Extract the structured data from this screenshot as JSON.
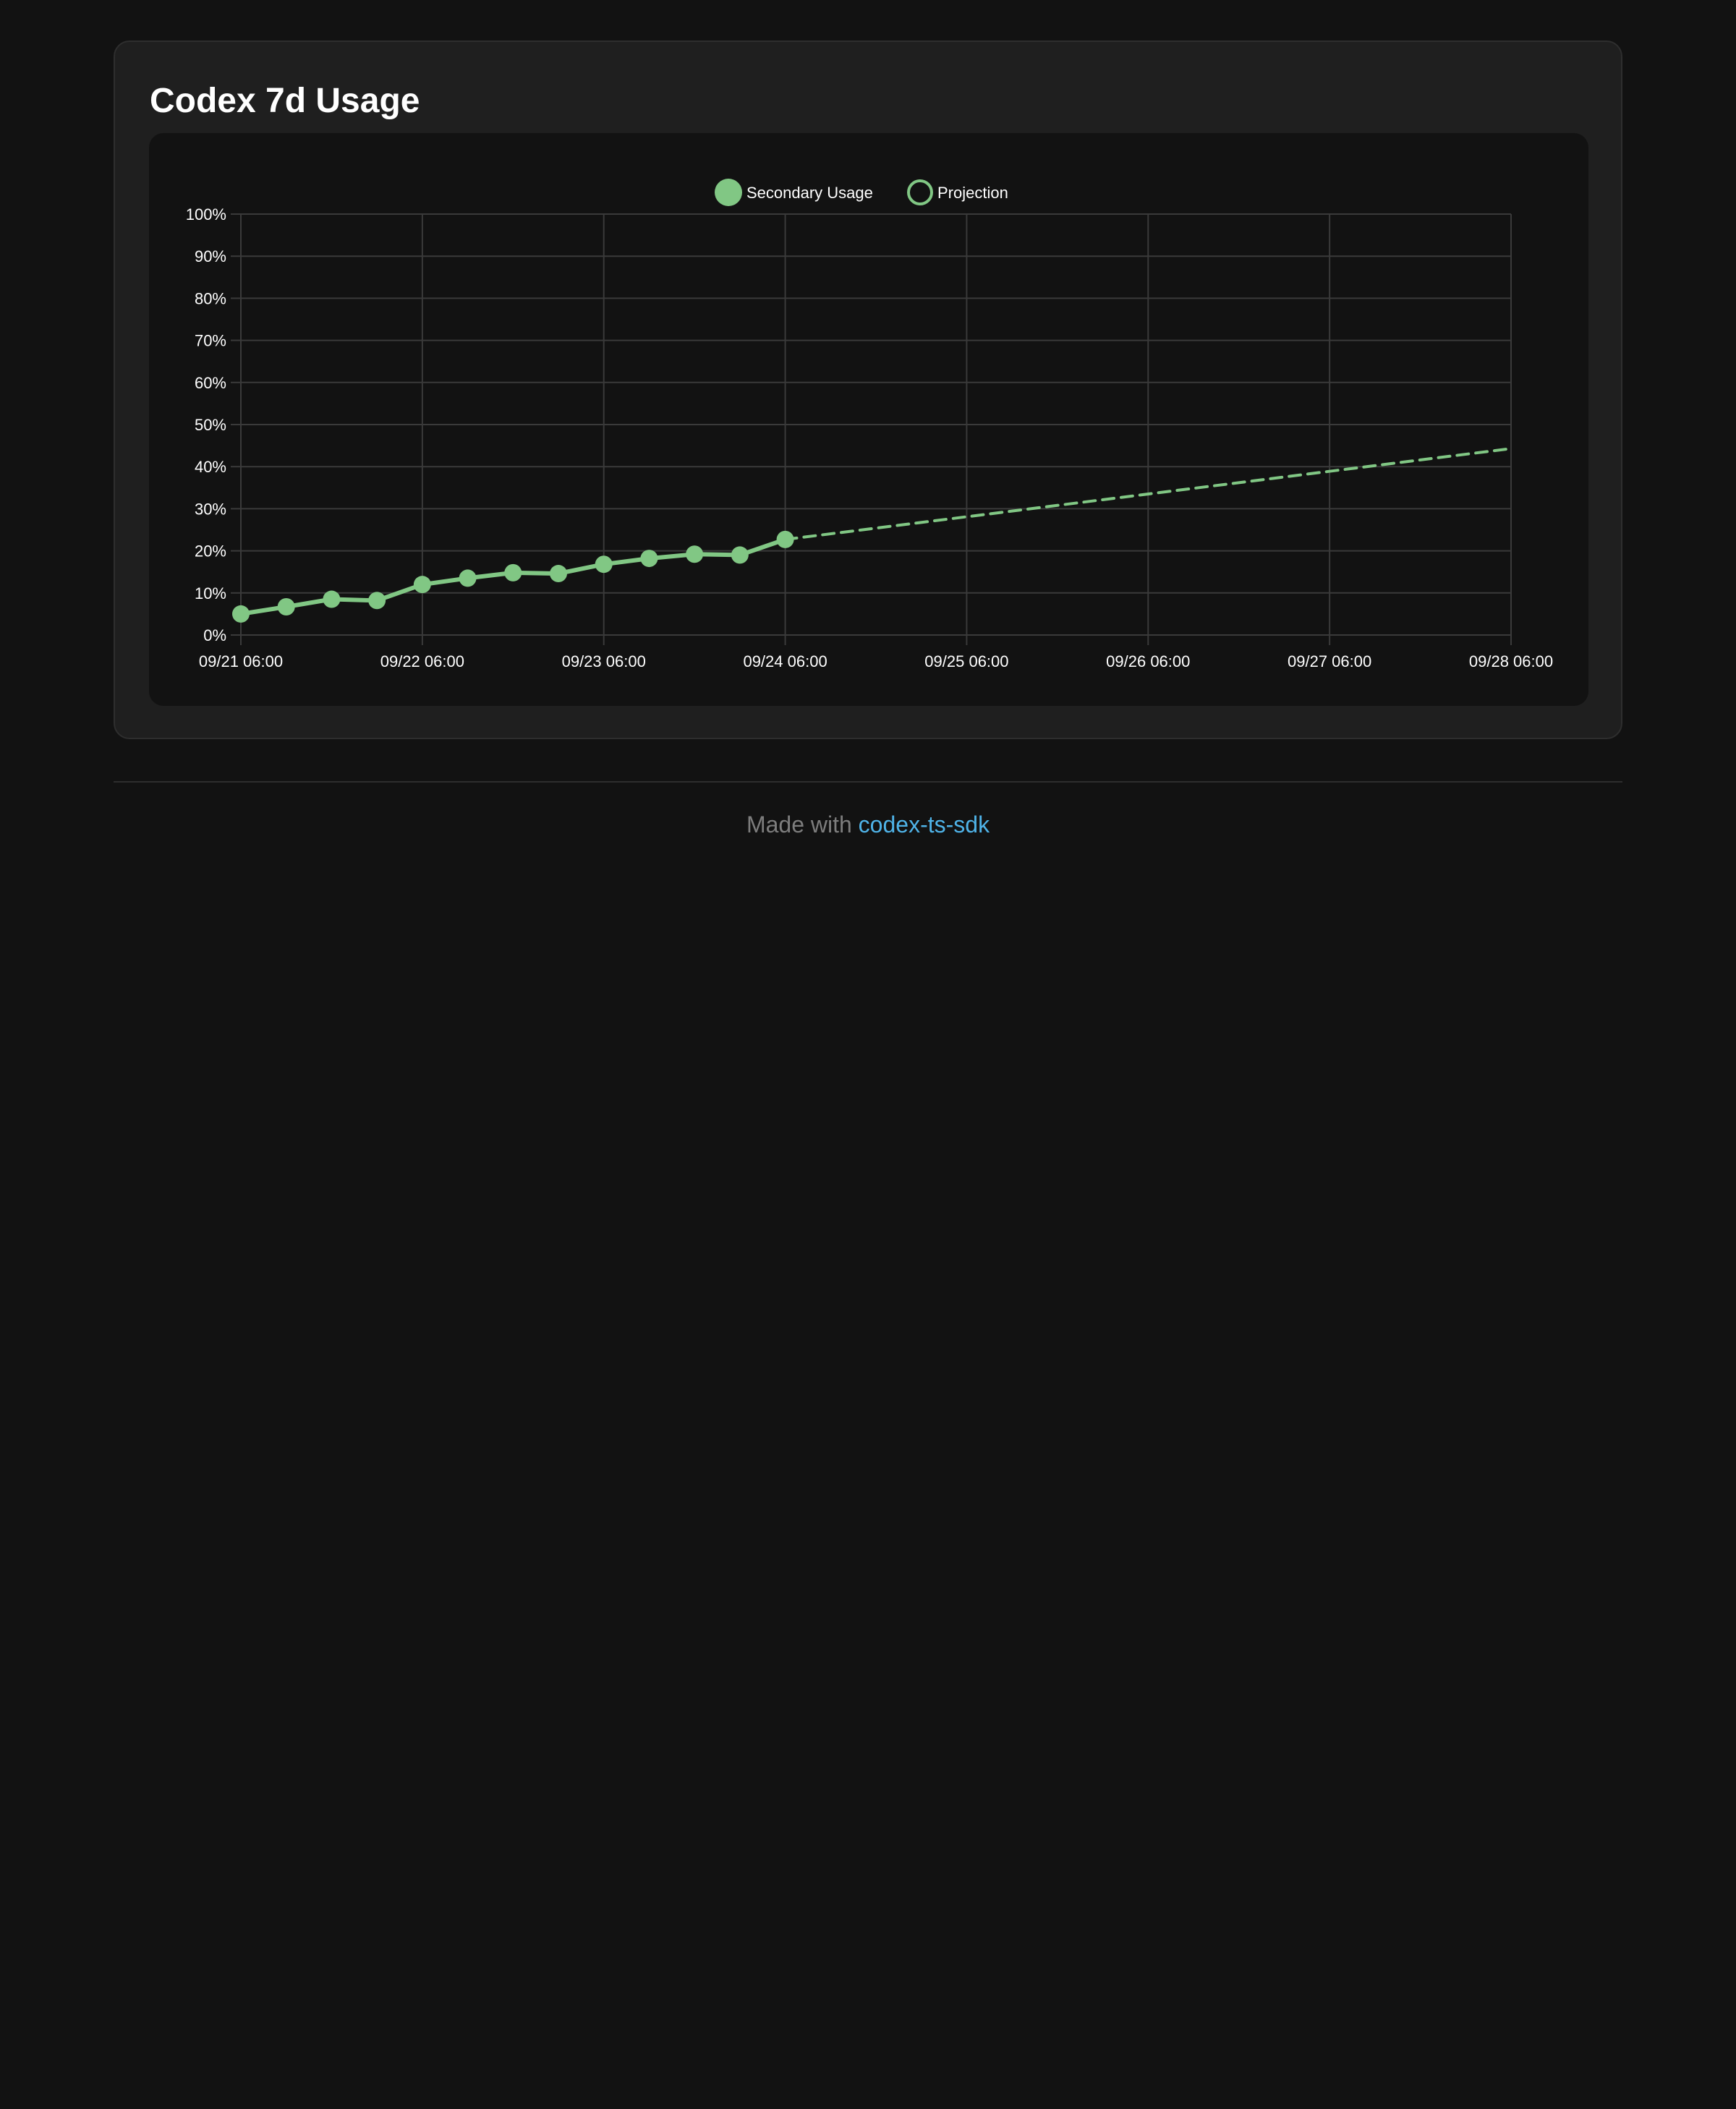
{
  "card": {
    "title": "Codex 7d Usage"
  },
  "colors": {
    "series": "#81c784",
    "background": "#121212",
    "card": "#1f1f1f",
    "grid": "#3a3a3a",
    "link": "#4fb3e8"
  },
  "chart_data": {
    "type": "line",
    "title": "",
    "xlabel": "",
    "ylabel": "",
    "ylim": [
      0,
      100
    ],
    "xlim": [
      "09/21 06:00",
      "09/28 06:00"
    ],
    "x_ticks": [
      "09/21 06:00",
      "09/22 06:00",
      "09/23 06:00",
      "09/24 06:00",
      "09/25 06:00",
      "09/26 06:00",
      "09/27 06:00",
      "09/28 06:00"
    ],
    "y_ticks": [
      "0%",
      "10%",
      "20%",
      "30%",
      "40%",
      "50%",
      "60%",
      "70%",
      "80%",
      "90%",
      "100%"
    ],
    "grid": true,
    "legend_position": "top-center",
    "series": [
      {
        "name": "Secondary Usage",
        "style": "solid",
        "marker": "filled-circle",
        "points": [
          {
            "x": "09/21 06:00",
            "y": 5
          },
          {
            "x": "09/21 12:00",
            "y": 6.7
          },
          {
            "x": "09/21 18:00",
            "y": 8.5
          },
          {
            "x": "09/22 00:00",
            "y": 8.2
          },
          {
            "x": "09/22 06:00",
            "y": 12
          },
          {
            "x": "09/22 12:00",
            "y": 13.5
          },
          {
            "x": "09/22 18:00",
            "y": 14.8
          },
          {
            "x": "09/23 00:00",
            "y": 14.6
          },
          {
            "x": "09/23 06:00",
            "y": 16.8
          },
          {
            "x": "09/23 12:00",
            "y": 18.2
          },
          {
            "x": "09/23 18:00",
            "y": 19.2
          },
          {
            "x": "09/24 00:00",
            "y": 19
          },
          {
            "x": "09/24 06:00",
            "y": 22.7
          }
        ]
      },
      {
        "name": "Projection",
        "style": "dashed",
        "marker": "hollow-circle",
        "points": [
          {
            "x": "09/24 06:00",
            "y": 22.7
          },
          {
            "x": "09/28 06:00",
            "y": 44.3
          }
        ]
      }
    ]
  },
  "footer": {
    "prefix": "Made with",
    "link_text": "codex-ts-sdk"
  }
}
